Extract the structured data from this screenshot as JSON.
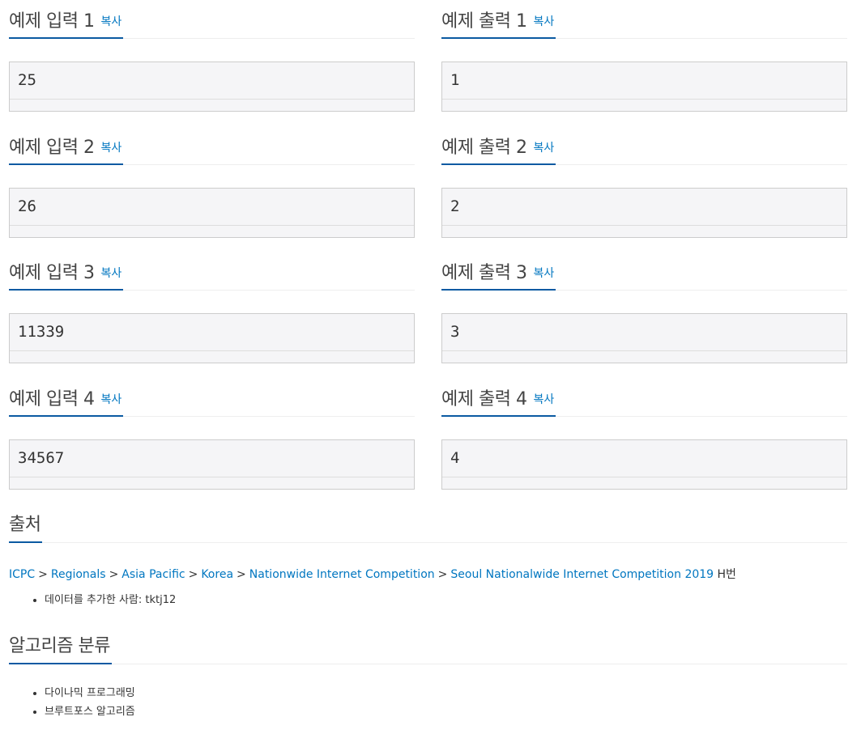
{
  "samples": [
    {
      "input_title": "예제 입력 1",
      "input_value": "25",
      "output_title": "예제 출력 1",
      "output_value": "1"
    },
    {
      "input_title": "예제 입력 2",
      "input_value": "26",
      "output_title": "예제 출력 2",
      "output_value": "2"
    },
    {
      "input_title": "예제 입력 3",
      "input_value": "11339",
      "output_title": "예제 출력 3",
      "output_value": "3"
    },
    {
      "input_title": "예제 입력 4",
      "input_value": "34567",
      "output_title": "예제 출력 4",
      "output_value": "4"
    }
  ],
  "copy_label": "복사",
  "source": {
    "title": "출처",
    "breadcrumb": [
      "ICPC",
      "Regionals",
      "Asia Pacific",
      "Korea",
      "Nationwide Internet Competition",
      "Seoul Nationalwide Internet Competition 2019"
    ],
    "separator": ">",
    "suffix": "H번",
    "data_added_by": "데이터를 추가한 사람: tktj12"
  },
  "algorithm": {
    "title": "알고리즘 분류",
    "items": [
      "다이나믹 프로그래밍",
      "브루트포스 알고리즘"
    ]
  },
  "colors": {
    "accent_underline": "#0b5aa2",
    "link": "#0076c0",
    "sample_bg": "#f5f5f7"
  }
}
